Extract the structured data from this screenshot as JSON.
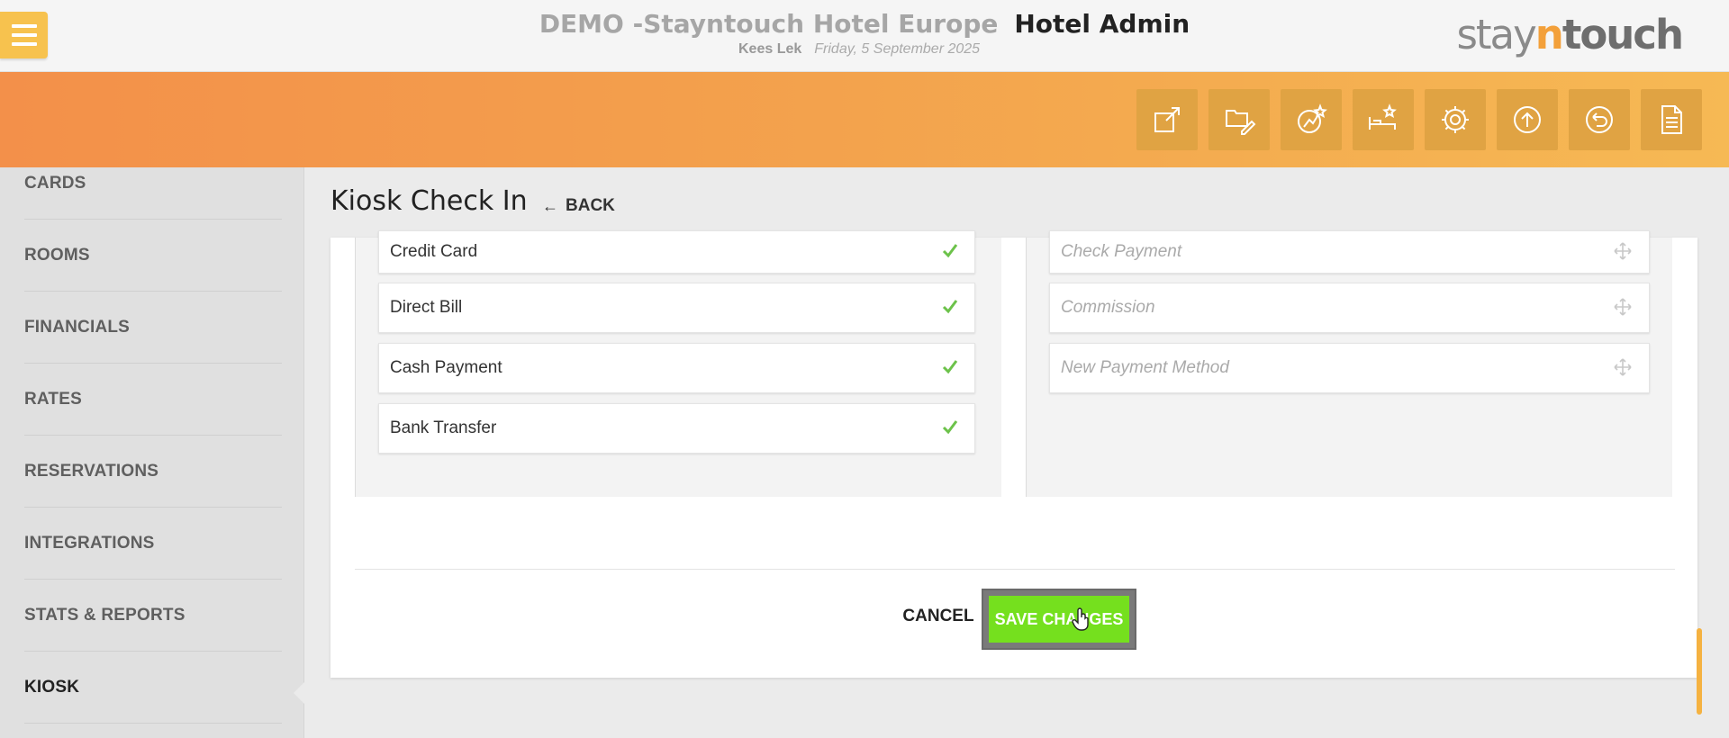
{
  "header": {
    "hotel_name": "DEMO -Stayntouch Hotel Europe",
    "section": "Hotel Admin",
    "user": "Kees Lek",
    "date": "Friday, 5 September 2025",
    "logo": {
      "part1": "stay",
      "part2": "n",
      "part3": "touch",
      "accent_color": "#f3a03a"
    }
  },
  "toolbar": {
    "icons": [
      "external-link-icon",
      "folder-edit-icon",
      "chart-star-icon",
      "bed-star-icon",
      "gear-icon",
      "upload-icon",
      "undo-icon",
      "document-icon"
    ]
  },
  "sidebar": {
    "items": [
      {
        "label": "CARDS"
      },
      {
        "label": "ROOMS"
      },
      {
        "label": "FINANCIALS"
      },
      {
        "label": "RATES"
      },
      {
        "label": "RESERVATIONS"
      },
      {
        "label": "INTEGRATIONS"
      },
      {
        "label": "STATS & REPORTS"
      },
      {
        "label": "KIOSK",
        "active": true
      }
    ]
  },
  "page": {
    "title": "Kiosk Check In",
    "back_label": "BACK"
  },
  "payments": {
    "selected": [
      "Credit Card",
      "Direct Bill",
      "Cash Payment",
      "Bank Transfer"
    ],
    "available": [
      "Check Payment",
      "Commission",
      "New Payment Method"
    ]
  },
  "actions": {
    "cancel_label": "CANCEL",
    "save_label": "SAVE CHANGES",
    "save_color": "#75e01e"
  }
}
